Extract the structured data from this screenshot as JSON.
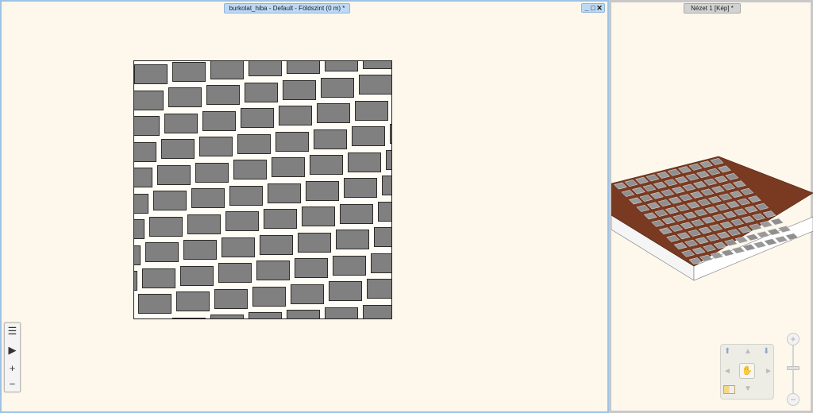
{
  "plan_window": {
    "title": "burkolat_hiba - Default - Földszint (0 m) *",
    "minimize": "_",
    "maximize": "□",
    "close": "✕"
  },
  "view_window": {
    "title": "Nézet 1 [Kép] *"
  },
  "side_toolbar": {
    "items": [
      {
        "icon": "list-icon",
        "glyph": "☰"
      },
      {
        "icon": "play-icon",
        "glyph": "▶"
      },
      {
        "icon": "plus-icon",
        "glyph": "+"
      },
      {
        "icon": "minus-icon",
        "glyph": "−"
      }
    ]
  },
  "nav_pad": {
    "up_glyph": "▲",
    "down_glyph": "▼",
    "left_glyph": "◄",
    "right_glyph": "►",
    "fwd_glyph": "⬆",
    "back_glyph": "⬇",
    "hand_glyph": "✋"
  },
  "zoom": {
    "plus": "+",
    "minus": "−"
  },
  "colors": {
    "tile_fill": "#808080",
    "grout_3d": "#7a3a22",
    "background": "#fdf7ec"
  }
}
